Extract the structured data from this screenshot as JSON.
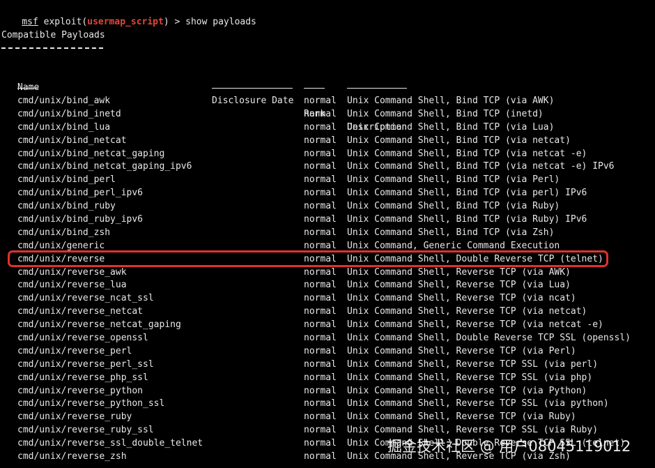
{
  "prompt": {
    "msf": "msf",
    "exploit_prefix": " exploit(",
    "module": "usermap_script",
    "suffix": ") > show payloads"
  },
  "section_title": "Compatible Payloads",
  "columns": {
    "name": "Name",
    "disclosure_date": "Disclosure Date",
    "rank": "Rank",
    "description": "Description"
  },
  "payloads": [
    {
      "name": "cmd/unix/bind_awk",
      "rank": "normal",
      "description": "Unix Command Shell, Bind TCP (via AWK)"
    },
    {
      "name": "cmd/unix/bind_inetd",
      "rank": "normal",
      "description": "Unix Command Shell, Bind TCP (inetd)"
    },
    {
      "name": "cmd/unix/bind_lua",
      "rank": "normal",
      "description": "Unix Command Shell, Bind TCP (via Lua)"
    },
    {
      "name": "cmd/unix/bind_netcat",
      "rank": "normal",
      "description": "Unix Command Shell, Bind TCP (via netcat)"
    },
    {
      "name": "cmd/unix/bind_netcat_gaping",
      "rank": "normal",
      "description": "Unix Command Shell, Bind TCP (via netcat -e)"
    },
    {
      "name": "cmd/unix/bind_netcat_gaping_ipv6",
      "rank": "normal",
      "description": "Unix Command Shell, Bind TCP (via netcat -e) IPv6"
    },
    {
      "name": "cmd/unix/bind_perl",
      "rank": "normal",
      "description": "Unix Command Shell, Bind TCP (via Perl)"
    },
    {
      "name": "cmd/unix/bind_perl_ipv6",
      "rank": "normal",
      "description": "Unix Command Shell, Bind TCP (via perl) IPv6"
    },
    {
      "name": "cmd/unix/bind_ruby",
      "rank": "normal",
      "description": "Unix Command Shell, Bind TCP (via Ruby)"
    },
    {
      "name": "cmd/unix/bind_ruby_ipv6",
      "rank": "normal",
      "description": "Unix Command Shell, Bind TCP (via Ruby) IPv6"
    },
    {
      "name": "cmd/unix/bind_zsh",
      "rank": "normal",
      "description": "Unix Command Shell, Bind TCP (via Zsh)"
    },
    {
      "name": "cmd/unix/generic",
      "rank": "normal",
      "description": "Unix Command, Generic Command Execution"
    },
    {
      "name": "cmd/unix/reverse",
      "rank": "normal",
      "description": "Unix Command Shell, Double Reverse TCP (telnet)",
      "highlighted": true
    },
    {
      "name": "cmd/unix/reverse_awk",
      "rank": "normal",
      "description": "Unix Command Shell, Reverse TCP (via AWK)"
    },
    {
      "name": "cmd/unix/reverse_lua",
      "rank": "normal",
      "description": "Unix Command Shell, Reverse TCP (via Lua)"
    },
    {
      "name": "cmd/unix/reverse_ncat_ssl",
      "rank": "normal",
      "description": "Unix Command Shell, Reverse TCP (via ncat)"
    },
    {
      "name": "cmd/unix/reverse_netcat",
      "rank": "normal",
      "description": "Unix Command Shell, Reverse TCP (via netcat)"
    },
    {
      "name": "cmd/unix/reverse_netcat_gaping",
      "rank": "normal",
      "description": "Unix Command Shell, Reverse TCP (via netcat -e)"
    },
    {
      "name": "cmd/unix/reverse_openssl",
      "rank": "normal",
      "description": "Unix Command Shell, Double Reverse TCP SSL (openssl)"
    },
    {
      "name": "cmd/unix/reverse_perl",
      "rank": "normal",
      "description": "Unix Command Shell, Reverse TCP (via Perl)"
    },
    {
      "name": "cmd/unix/reverse_perl_ssl",
      "rank": "normal",
      "description": "Unix Command Shell, Reverse TCP SSL (via perl)"
    },
    {
      "name": "cmd/unix/reverse_php_ssl",
      "rank": "normal",
      "description": "Unix Command Shell, Reverse TCP SSL (via php)"
    },
    {
      "name": "cmd/unix/reverse_python",
      "rank": "normal",
      "description": "Unix Command Shell, Reverse TCP (via Python)"
    },
    {
      "name": "cmd/unix/reverse_python_ssl",
      "rank": "normal",
      "description": "Unix Command Shell, Reverse TCP SSL (via python)"
    },
    {
      "name": "cmd/unix/reverse_ruby",
      "rank": "normal",
      "description": "Unix Command Shell, Reverse TCP (via Ruby)"
    },
    {
      "name": "cmd/unix/reverse_ruby_ssl",
      "rank": "normal",
      "description": "Unix Command Shell, Reverse TCP SSL (via Ruby)"
    },
    {
      "name": "cmd/unix/reverse_ssl_double_telnet",
      "rank": "normal",
      "description": "Unix Command Shell, Double Reverse TCP SSL (telnet)"
    },
    {
      "name": "cmd/unix/reverse_zsh",
      "rank": "normal",
      "description": "Unix Command Shell, Reverse TCP (via Zsh)"
    }
  ],
  "watermark": "掘金技术社区 @ 用户08045119012",
  "colors": {
    "background": "#000000",
    "text": "#e8e8e8",
    "module_name": "#e5473a",
    "highlight_border": "#e0322a"
  }
}
